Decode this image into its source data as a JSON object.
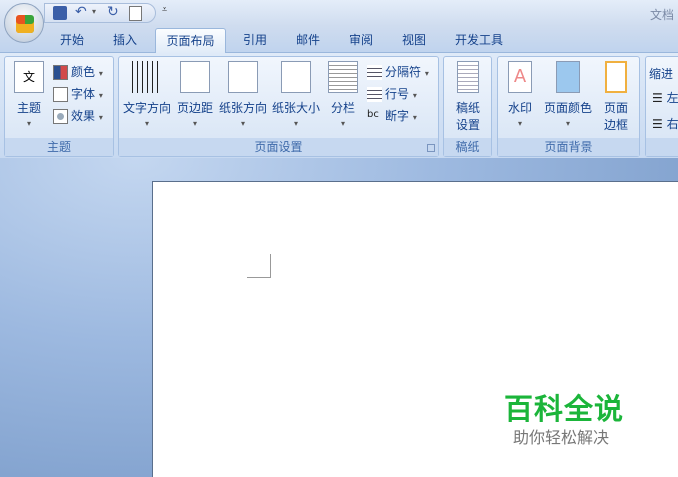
{
  "title": "文档",
  "qat": {
    "icons": [
      "save-icon",
      "undo-icon",
      "redo-icon",
      "print-preview-icon",
      "customize-icon"
    ]
  },
  "tabs": [
    "开始",
    "插入",
    "页面布局",
    "引用",
    "邮件",
    "审阅",
    "视图",
    "开发工具"
  ],
  "active_tab": "页面布局",
  "groups": {
    "theme": {
      "label": "主题",
      "themes": "主题",
      "colors": "颜色",
      "fonts": "字体",
      "effects": "效果"
    },
    "page_setup": {
      "label": "页面设置",
      "text_direction": "文字方向",
      "margins": "页边距",
      "orientation": "纸张方向",
      "size": "纸张大小",
      "columns": "分栏",
      "breaks": "分隔符",
      "line_numbers": "行号",
      "hyphenation": "断字"
    },
    "draft": {
      "label": "稿纸",
      "setup_l1": "稿纸",
      "setup_l2": "设置"
    },
    "background": {
      "label": "页面背景",
      "watermark": "水印",
      "page_color": "页面颜色",
      "borders_l1": "页面",
      "borders_l2": "边框"
    },
    "paragraph": {
      "indent": "缩进",
      "left": "左",
      "right": "右"
    }
  },
  "watermark": {
    "title": "百科全说",
    "subtitle": "助你轻松解决",
    "color": "#1bb53a"
  }
}
